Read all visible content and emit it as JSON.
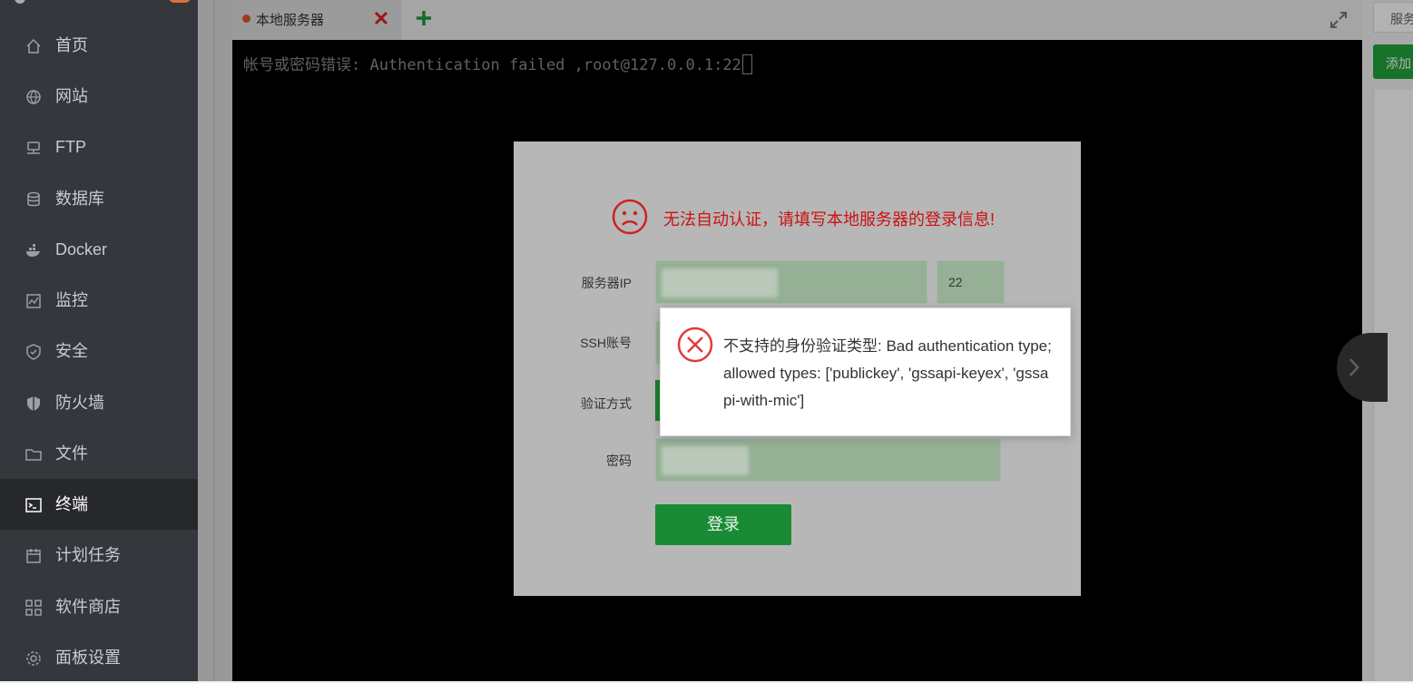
{
  "sidebar": {
    "items": [
      {
        "label": "首页",
        "icon": "home-icon"
      },
      {
        "label": "网站",
        "icon": "globe-icon"
      },
      {
        "label": "FTP",
        "icon": "ftp-icon"
      },
      {
        "label": "数据库",
        "icon": "database-icon"
      },
      {
        "label": "Docker",
        "icon": "docker-icon"
      },
      {
        "label": "监控",
        "icon": "monitor-icon"
      },
      {
        "label": "安全",
        "icon": "shield-check-icon"
      },
      {
        "label": "防火墙",
        "icon": "firewall-shield-icon"
      },
      {
        "label": "文件",
        "icon": "folder-icon"
      },
      {
        "label": "终端",
        "icon": "terminal-icon",
        "active": true
      },
      {
        "label": "计划任务",
        "icon": "calendar-icon"
      },
      {
        "label": "软件商店",
        "icon": "apps-grid-icon"
      },
      {
        "label": "面板设置",
        "icon": "gear-icon"
      }
    ]
  },
  "terminal": {
    "tab_label": "本地服务器",
    "output_line": "帐号或密码错误: Authentication failed ,root@127.0.0.1:22"
  },
  "right_panel": {
    "button_server": "服务器",
    "button_add": "添加"
  },
  "login_modal": {
    "title": "无法自动认证，请填写本地服务器的登录信息!",
    "server_ip_label": "服务器IP",
    "port_value": "22",
    "ssh_account_label": "SSH账号",
    "auth_method_label": "验证方式",
    "password_label": "密码",
    "submit_label": "登录"
  },
  "error_toast": {
    "message": "不支持的身份验证类型: Bad authentication type; allowed types: ['publickey', 'gssapi-keyex', 'gssapi-with-mic']"
  },
  "colors": {
    "sidebar_bg": "#34373c",
    "active_item_bg": "#26282c",
    "accent_green": "#20a53a",
    "error_red": "#cc1111",
    "tab_dot": "#e0572d"
  }
}
